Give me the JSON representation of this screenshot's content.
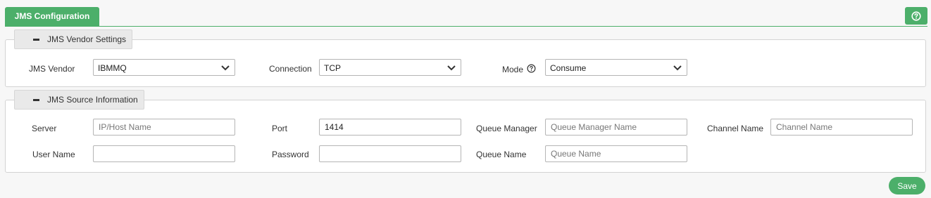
{
  "header": {
    "tab_label": "JMS Configuration",
    "help_icon": "help-circle-icon"
  },
  "vendor_section": {
    "title": "JMS Vendor Settings",
    "vendor": {
      "label": "JMS Vendor",
      "value": "IBMMQ"
    },
    "connection": {
      "label": "Connection",
      "value": "TCP"
    },
    "mode": {
      "label": "Mode",
      "value": "Consume",
      "help_icon": "help-circle-icon"
    }
  },
  "source_section": {
    "title": "JMS Source Information",
    "server": {
      "label": "Server",
      "value": "",
      "placeholder": "IP/Host Name"
    },
    "port": {
      "label": "Port",
      "value": "1414",
      "placeholder": ""
    },
    "queue_manager": {
      "label": "Queue Manager",
      "value": "",
      "placeholder": "Queue Manager Name"
    },
    "channel_name": {
      "label": "Channel Name",
      "value": "",
      "placeholder": "Channel Name"
    },
    "user_name": {
      "label": "User Name",
      "value": "",
      "placeholder": ""
    },
    "password": {
      "label": "Password",
      "value": "",
      "placeholder": ""
    },
    "queue_name": {
      "label": "Queue Name",
      "value": "",
      "placeholder": "Queue Name"
    }
  },
  "actions": {
    "save_label": "Save"
  },
  "colors": {
    "accent": "#4caf6a",
    "border": "#d3d3d3"
  }
}
